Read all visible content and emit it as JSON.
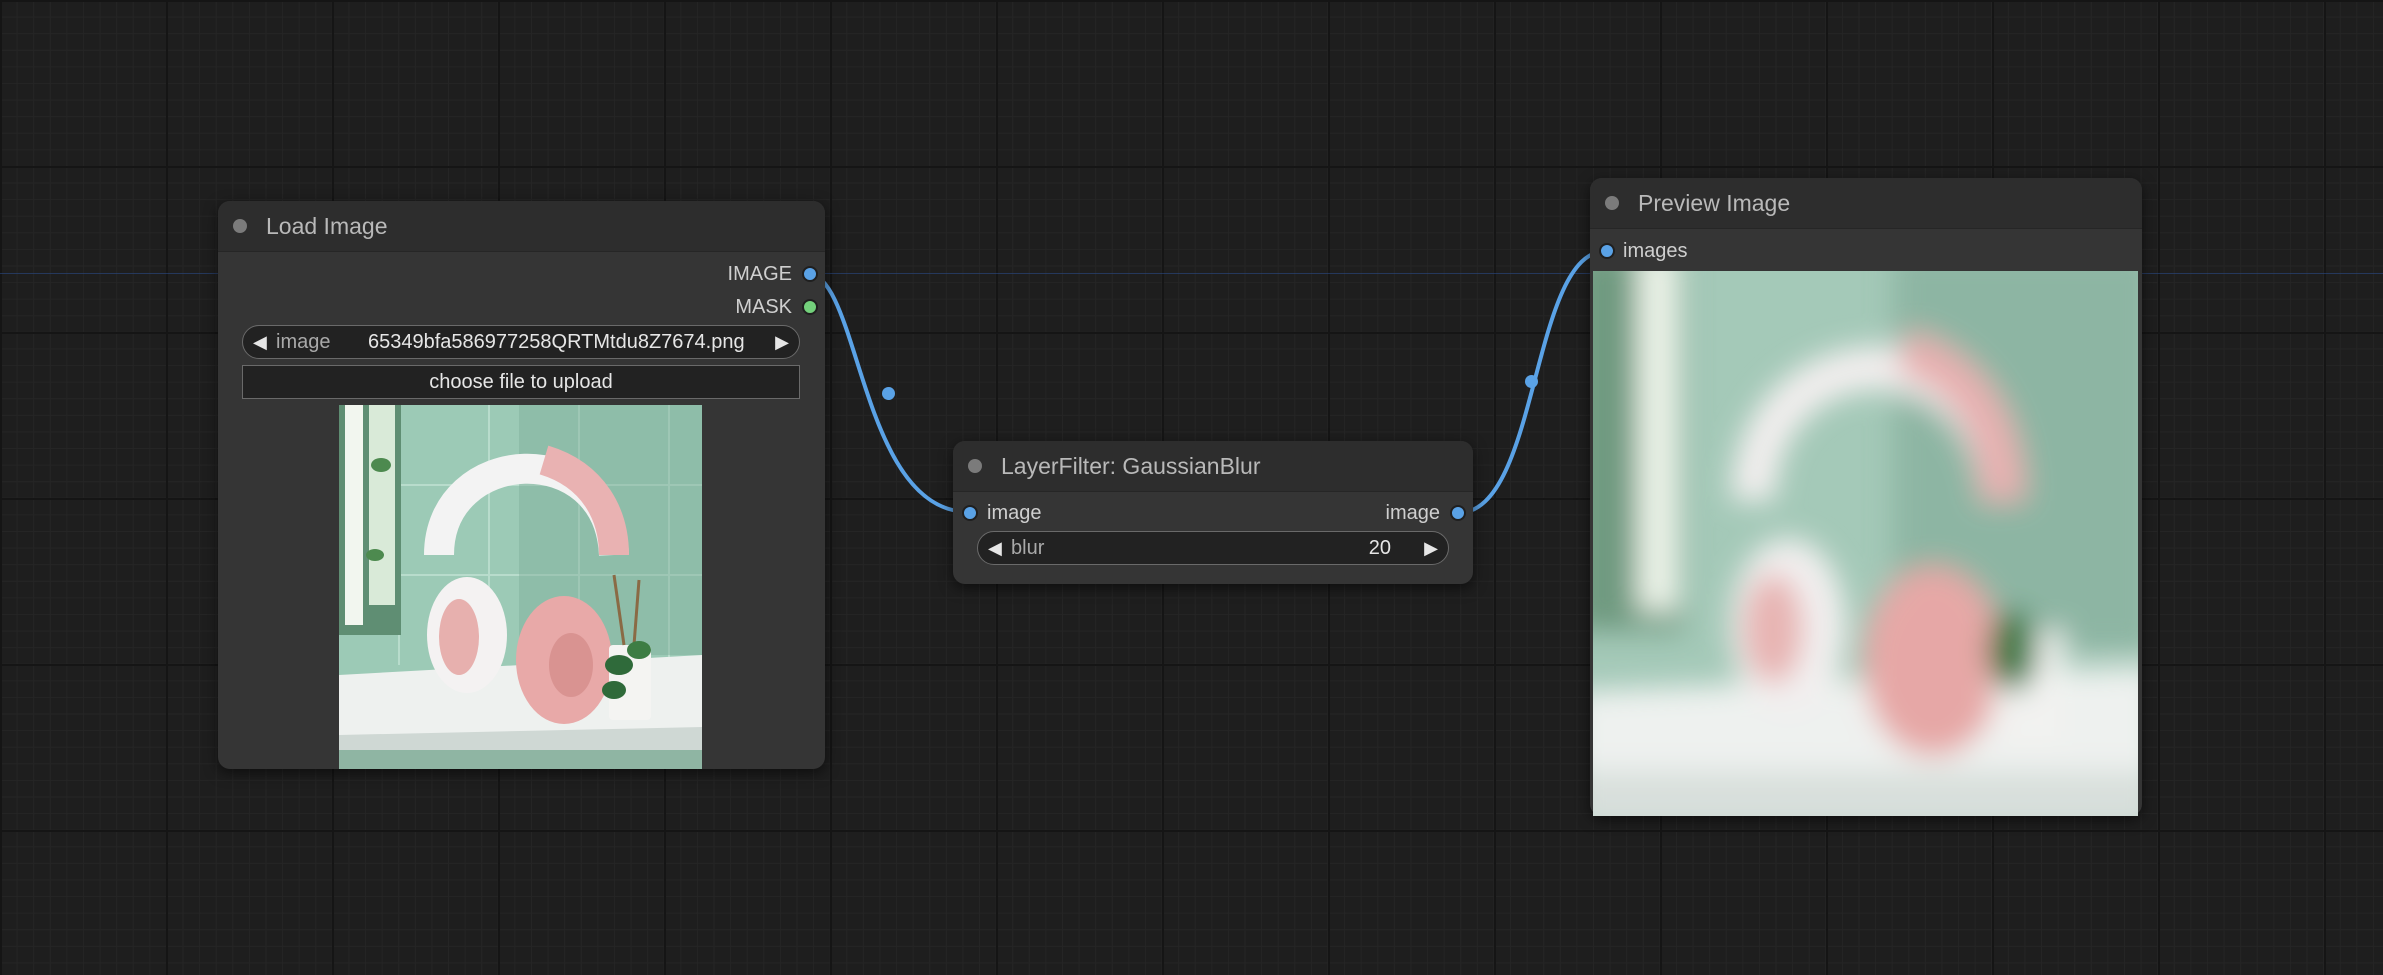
{
  "colors": {
    "link": "#5aa2e6",
    "image_slot": "#5aa2e6",
    "mask_slot": "#73d07b"
  },
  "load_image": {
    "title": "Load Image",
    "outputs": [
      "IMAGE",
      "MASK"
    ],
    "image_widget": {
      "name": "image",
      "value": "65349bfa586977258QRTMtdu8Z7674.png"
    },
    "upload_label": "choose file to upload"
  },
  "gaussian_blur": {
    "title": "LayerFilter: GaussianBlur",
    "input_label": "image",
    "output_label": "image",
    "blur_widget": {
      "name": "blur",
      "value": "20"
    }
  },
  "preview_image": {
    "title": "Preview Image",
    "input_label": "images"
  }
}
